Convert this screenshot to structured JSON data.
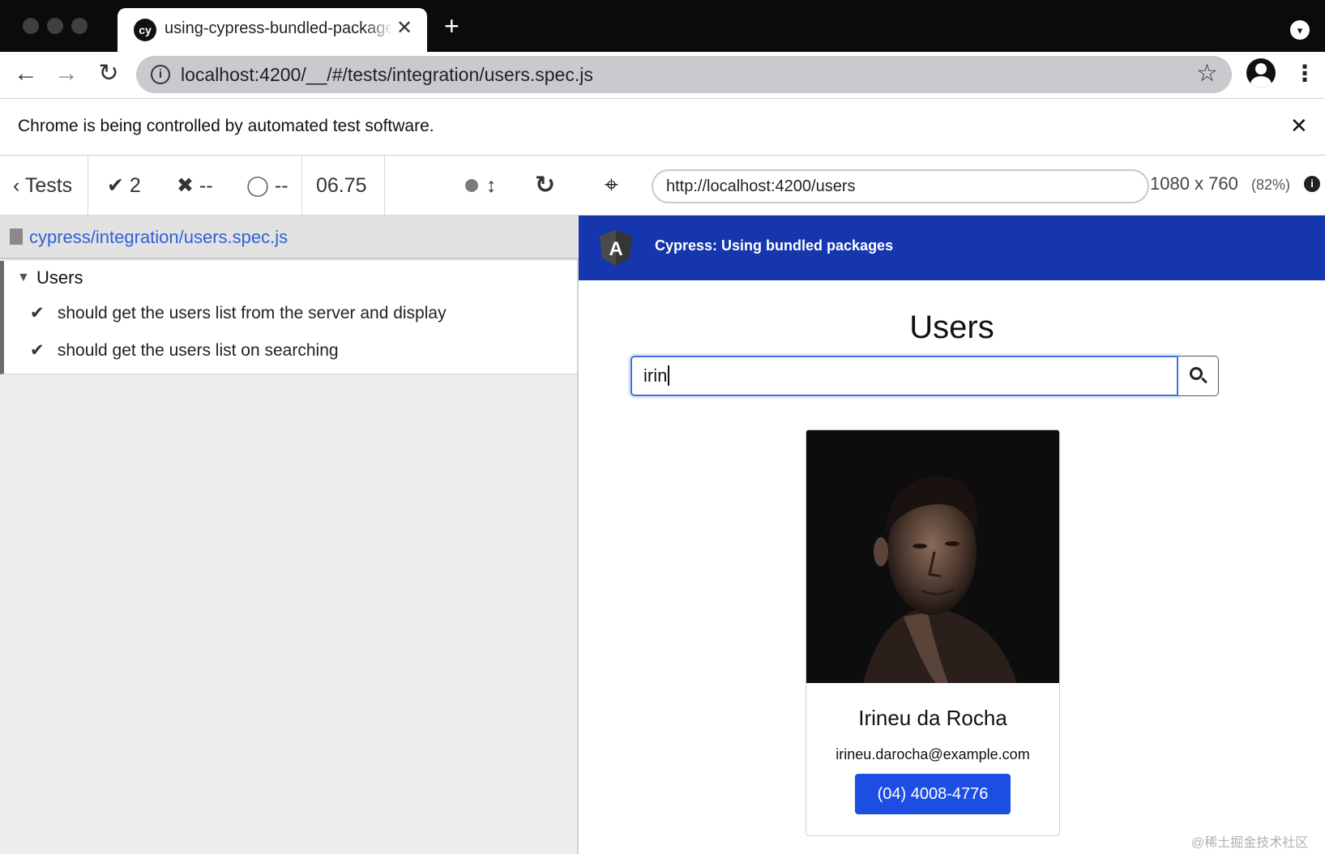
{
  "browser": {
    "tab": {
      "favicon_text": "cy",
      "title": "using-cypress-bundled-packages",
      "close_glyph": "✕"
    },
    "new_tab_glyph": "+",
    "menu_glyph": "▾",
    "toolbar": {
      "back_glyph": "←",
      "forward_glyph": "→",
      "reload_glyph": "↻",
      "info_glyph": "i",
      "url": "localhost:4200/__/#/tests/integration/users.spec.js",
      "bookmark_glyph": "☆",
      "kebab_glyph": "⋮"
    },
    "infobar": {
      "message": "Chrome is being controlled by automated test software.",
      "close_glyph": "✕"
    }
  },
  "reporter": {
    "back_label": "‹ Tests",
    "passed": {
      "glyph": "✔",
      "count": "2"
    },
    "failed": {
      "glyph": "✖",
      "count": "--"
    },
    "pending": {
      "glyph": "◯",
      "count": "--"
    },
    "duration": "06.75",
    "scroll_glyph": "↕",
    "rerun_glyph": "↻",
    "spec_path": "cypress/integration/users.spec.js",
    "suite": {
      "caret": "▼",
      "title": "Users",
      "tests": [
        {
          "glyph": "✔",
          "title": "should get the users list from the server and display"
        },
        {
          "glyph": "✔",
          "title": "should get the users list on searching"
        }
      ]
    }
  },
  "aut": {
    "selector_glyph": "⌖",
    "url": "http://localhost:4200/users",
    "viewport_size": "1080 x 760",
    "viewport_scale": "(82%)",
    "viewport_info_glyph": "i",
    "app": {
      "logo_letter": "A",
      "nav_title": "Cypress: Using bundled packages",
      "page_title": "Users",
      "search_value": "irin",
      "users": [
        {
          "name": "Irineu da Rocha",
          "email": "irineu.darocha@example.com",
          "phone": "(04) 4008-4776"
        }
      ]
    }
  },
  "colors": {
    "cypress_link": "#2f5fd8",
    "app_nav": "#1536ad",
    "primary_button": "#1c4ee4",
    "title_bar": "#0b0b0b"
  },
  "watermark": "@稀土掘金技术社区"
}
